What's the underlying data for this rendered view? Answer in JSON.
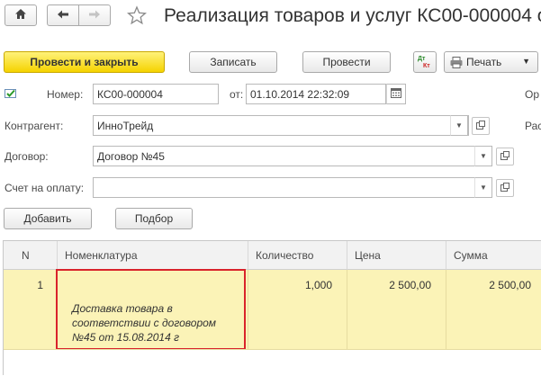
{
  "toolbar_top": {
    "home_icon": "home-icon",
    "back_icon": "arrow-left-icon",
    "forward_icon": "arrow-right-icon",
    "favorite_icon": "star-icon",
    "title": "Реализация товаров и услуг КС00-000004 о"
  },
  "commands": {
    "post_and_close": "Провести и закрыть",
    "save": "Записать",
    "post": "Провести",
    "print": "Печать",
    "dtkt_icon": "dt-kt-icon",
    "printer_icon": "printer-icon"
  },
  "form": {
    "number_label": "Номер:",
    "number_value": "КС00-000004",
    "date_label": "от:",
    "date_value": "01.10.2014 22:32:09",
    "org_label_partial": "Ор",
    "counterparty_label": "Контрагент:",
    "counterparty_value": "ИнноТрейд",
    "rasch_label_partial": "Рас",
    "contract_label": "Договор:",
    "contract_value": "Договор №45",
    "invoice_label": "Счет на оплату:",
    "invoice_value": ""
  },
  "table_commands": {
    "add": "Добавить",
    "select": "Подбор"
  },
  "table": {
    "columns": [
      "N",
      "Номенклатура",
      "Количество",
      "Цена",
      "Сумма"
    ],
    "rows": [
      {
        "n": "1",
        "item": "",
        "content_lines": [
          "Доставка товара в",
          "соответствии с договором",
          "№45 от 15.08.2014 г"
        ],
        "qty": "1,000",
        "price": "2 500,00",
        "sum": "2 500,00"
      }
    ]
  },
  "colors": {
    "primary_button": "#f5d300",
    "highlight_row": "#fbf3b7",
    "selection_border": "#d9232b"
  }
}
